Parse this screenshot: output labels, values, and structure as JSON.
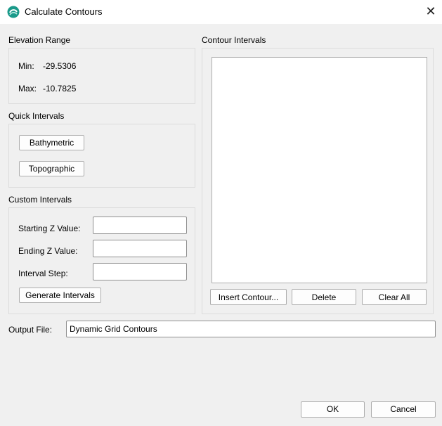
{
  "window": {
    "title": "Calculate Contours",
    "close_symbol": "✕"
  },
  "elevation_range": {
    "heading": "Elevation Range",
    "min_label": "Min:",
    "min_value": "-29.5306",
    "max_label": "Max:",
    "max_value": "-10.7825"
  },
  "quick_intervals": {
    "heading": "Quick Intervals",
    "bathymetric_label": "Bathymetric",
    "topographic_label": "Topographic"
  },
  "custom_intervals": {
    "heading": "Custom Intervals",
    "starting_label": "Starting Z Value:",
    "starting_value": "",
    "ending_label": "Ending Z Value:",
    "ending_value": "",
    "step_label": "Interval Step:",
    "step_value": "",
    "generate_label": "Generate Intervals"
  },
  "contour_intervals": {
    "heading": "Contour Intervals",
    "items": [],
    "insert_label": "Insert Contour...",
    "delete_label": "Delete",
    "clear_label": "Clear All"
  },
  "output": {
    "label": "Output File:",
    "value": "Dynamic Grid Contours"
  },
  "footer": {
    "ok_label": "OK",
    "cancel_label": "Cancel"
  },
  "icons": {
    "app": "app-logo-icon",
    "close": "close-icon"
  },
  "colors": {
    "app_icon": "#1a9a8a",
    "background": "#f0f0f0"
  }
}
